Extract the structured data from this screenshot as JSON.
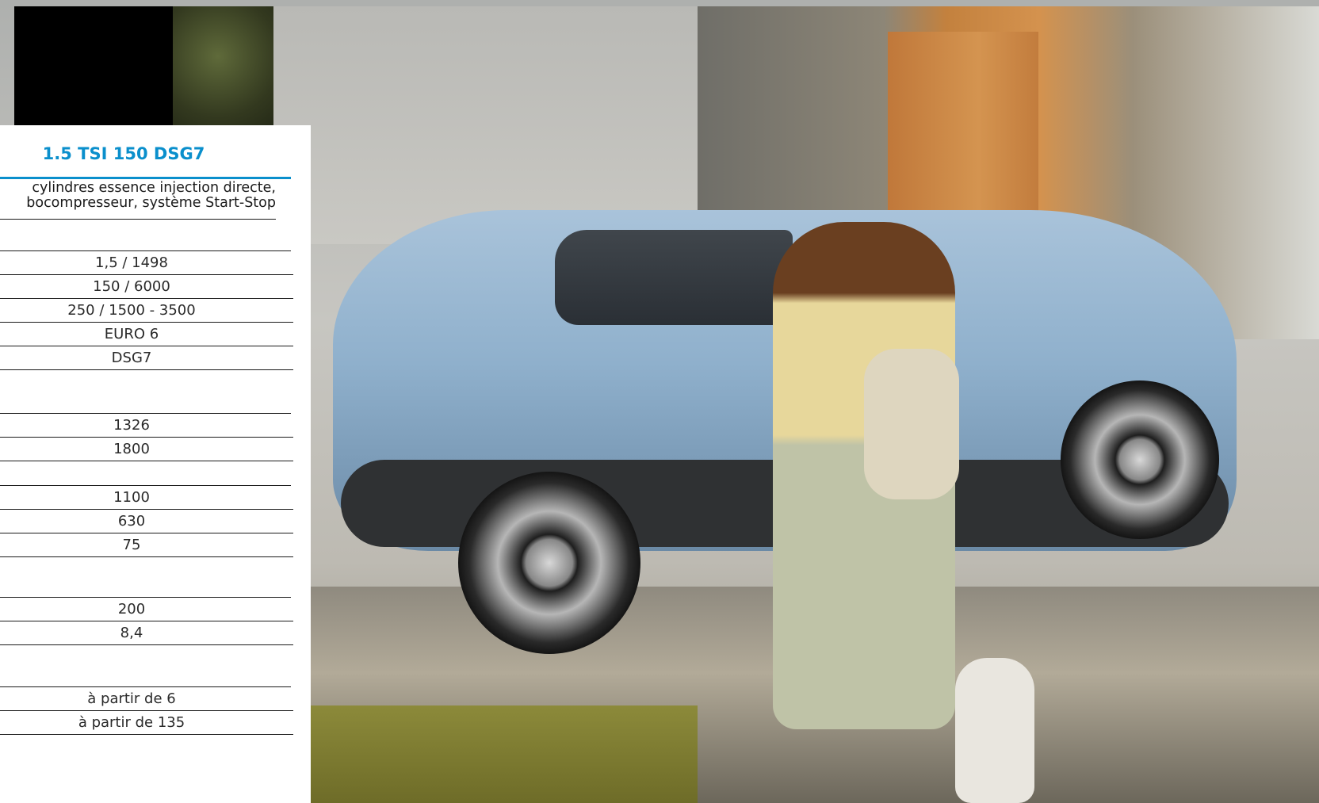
{
  "engine": {
    "title": "1.5 TSI 150 DSG7",
    "description_line1": "cylindres essence injection directe,",
    "description_line2": "bocompresseur, système Start-Stop"
  },
  "sections": [
    {
      "rows": [
        "1,5 / 1498",
        "150 / 6000",
        "250 / 1500 - 3500",
        "EURO 6",
        "DSG7"
      ]
    },
    {
      "rows": [
        "1326",
        "1800"
      ]
    },
    {
      "rows": [
        "1100",
        "630",
        "75"
      ]
    },
    {
      "rows": [
        "200",
        "8,4"
      ]
    },
    {
      "rows": [
        "à partir de 6",
        "à partir de 135"
      ]
    }
  ],
  "colors": {
    "accent": "#0a8fcc",
    "rule": "#1a1a1a",
    "text": "#2a2a2a"
  }
}
